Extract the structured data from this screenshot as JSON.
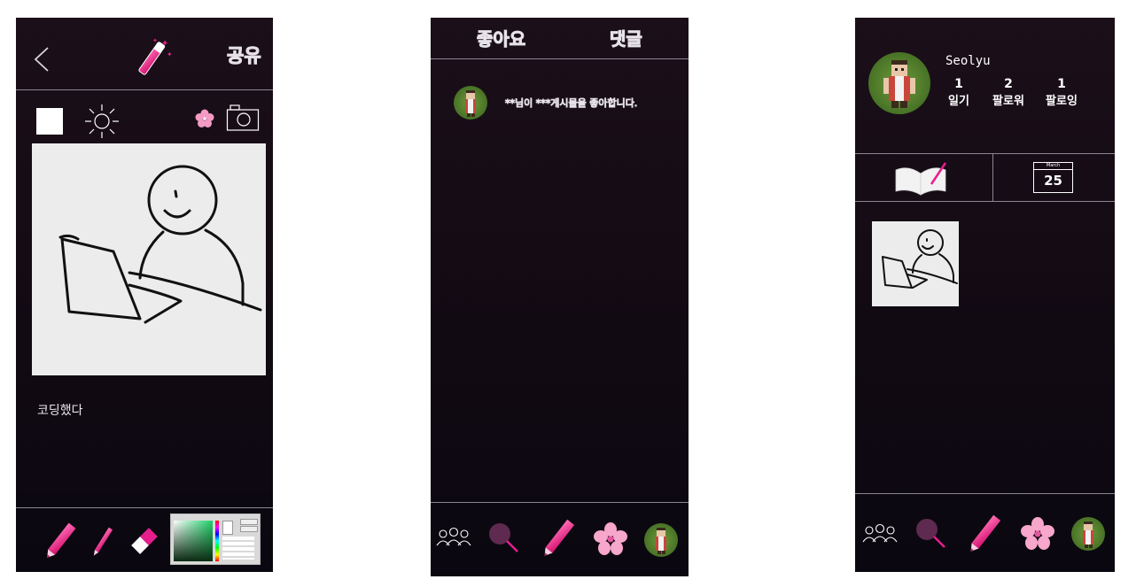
{
  "colors": {
    "accent_pink": "#e61e8c",
    "phone_bg": "#140b14",
    "canvas_bg": "#ececec",
    "divider": "#8a8690"
  },
  "screen1": {
    "header": {
      "share_label": "공유"
    },
    "caption": "코딩했다"
  },
  "screen2": {
    "tabs": [
      "좋아요",
      "댓글"
    ],
    "notification": "**님이 ***게시물을 좋아합니다."
  },
  "screen3": {
    "username": "Seolyu",
    "stats": [
      {
        "value": "1",
        "label": "일기"
      },
      {
        "value": "2",
        "label": "팔로워"
      },
      {
        "value": "1",
        "label": "팔로잉"
      }
    ],
    "calendar": {
      "month": "March",
      "day": "25"
    }
  },
  "icons": {
    "back": "chevron-left-icon",
    "magic_wand": "magic-wand-icon",
    "square": "white-square-icon",
    "brightness": "sun-icon",
    "flower": "cherry-blossom-icon",
    "camera": "camera-icon",
    "pencil": "pencil-icon",
    "eraser": "eraser-icon",
    "people": "people-icon",
    "search": "magnifier-icon",
    "book": "open-book-icon"
  }
}
